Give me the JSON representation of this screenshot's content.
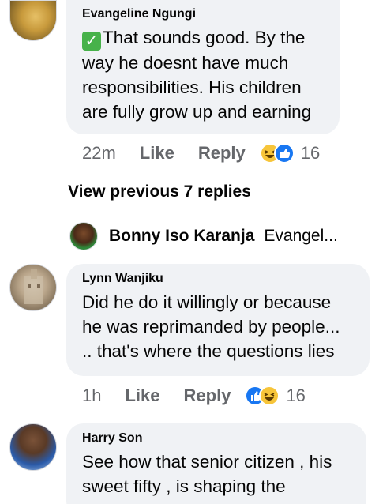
{
  "comments": [
    {
      "author": "Evangeline Ngungi",
      "text": "That sounds good. By the way he doesnt have much responsibilities.  His children are fully grow up and earning",
      "time": "22m",
      "like": "Like",
      "reply": "Reply",
      "reaction_count": "16",
      "reactions": [
        "haha-emoji",
        "like-emoji"
      ],
      "prefix_icon": "check-mark-icon"
    },
    {
      "author": "Lynn Wanjiku",
      "text_lines": [
        "Did he do it willingly or because",
        "he was reprimanded by people...",
        ".. that's where the questions lies"
      ],
      "time": "1h",
      "like": "Like",
      "reply": "Reply",
      "reaction_count": "16",
      "reactions": [
        "like-emoji",
        "haha-emoji"
      ]
    },
    {
      "author": "Harry Son",
      "text_lines": [
        "See how that senior citizen , his",
        "sweet fifty , is shaping the"
      ]
    }
  ],
  "view_previous": "View previous 7 replies",
  "reply_preview": {
    "author": "Bonny Iso Karanja",
    "snippet": "Evangel..."
  },
  "colors": {
    "bubble": "#f0f2f5",
    "meta_text": "#65676b",
    "like_blue": "#1877f2",
    "haha_yellow": "#f7c53a",
    "check_green": "#47b24a"
  }
}
